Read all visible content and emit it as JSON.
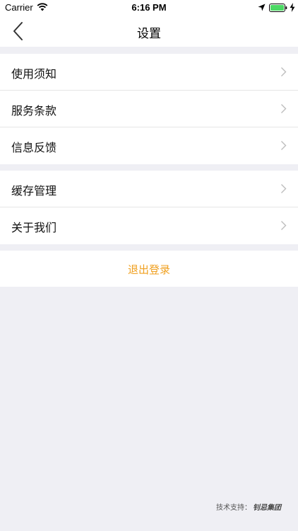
{
  "status_bar": {
    "carrier": "Carrier",
    "time": "6:16 PM",
    "icons": [
      "wifi-icon",
      "location-arrow-icon",
      "battery-icon",
      "charging-bolt-icon"
    ],
    "battery_color": "#4cd964"
  },
  "nav": {
    "title": "设置",
    "back_icon": "chevron-left-icon"
  },
  "settings": {
    "group1": [
      {
        "label": "使用须知"
      },
      {
        "label": "服务条款"
      },
      {
        "label": "信息反馈"
      }
    ],
    "group2": [
      {
        "label": "缓存管理"
      },
      {
        "label": "关于我们"
      }
    ]
  },
  "logout": {
    "label": "退出登录",
    "color": "#f0a020"
  },
  "footer": {
    "label": "技术支持：",
    "brand": "钊忌集团"
  }
}
